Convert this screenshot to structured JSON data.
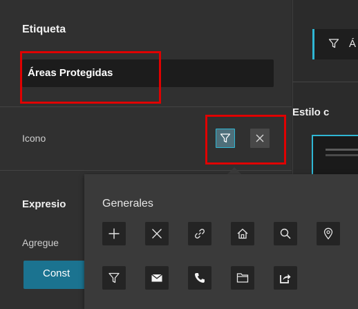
{
  "left_panel": {
    "label_section": {
      "title": "Etiqueta",
      "value": "Áreas Protegidas"
    },
    "icon_section": {
      "title": "Icono",
      "filter_icon": "filter-icon",
      "clear_icon": "close-icon"
    },
    "expression_section": {
      "title": "Expresio",
      "hint": "Agregue",
      "build_button_label": "Const"
    }
  },
  "right_panel": {
    "field_text": "Á",
    "field_icon": "filter-icon",
    "style_label": "Estilo c"
  },
  "icon_picker": {
    "category": "Generales",
    "icons": [
      {
        "name": "plus-icon"
      },
      {
        "name": "close-icon"
      },
      {
        "name": "link-icon"
      },
      {
        "name": "home-icon"
      },
      {
        "name": "search-icon"
      },
      {
        "name": "location-pin-icon"
      },
      {
        "name": "filter-icon"
      },
      {
        "name": "envelope-icon"
      },
      {
        "name": "phone-icon"
      },
      {
        "name": "folder-icon"
      },
      {
        "name": "share-icon"
      }
    ]
  },
  "colors": {
    "accent": "#2fb7d4",
    "button": "#1b7390",
    "highlight": "#e00000"
  }
}
